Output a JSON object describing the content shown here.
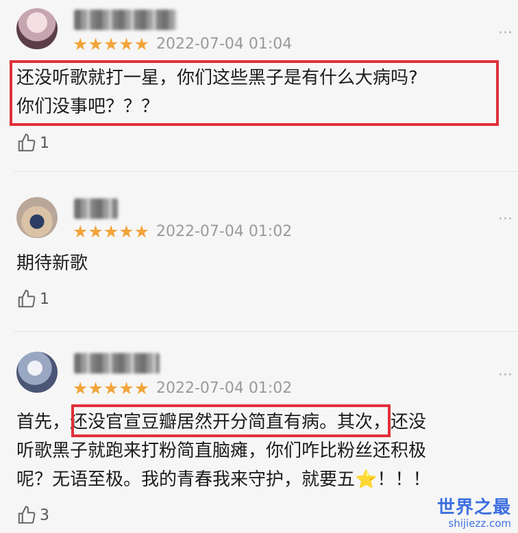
{
  "reviews": [
    {
      "rating_text": "★★★★★",
      "date": "2022-07-04 01:04",
      "text": "还没听歌就打一星，你们这些黑子是有什么大病吗?\n你们没事吧？？？",
      "likes": "1"
    },
    {
      "rating_text": "★★★★★",
      "date": "2022-07-04 01:02",
      "text": "期待新歌",
      "likes": "1"
    },
    {
      "rating_text": "★★★★★",
      "date": "2022-07-04 01:02",
      "text_before_highlight": "首先，",
      "text_highlight": "还没官宣豆瓣居然开分简直有病",
      "text_rest": "。其次，还没\n听歌黑子就跑来打粉简直脑瘫，你们咋比粉丝还积极\n呢？无语至极。我的青春我来守护，就要五",
      "text_end": "！！！",
      "likes": "3"
    }
  ],
  "watermark": {
    "main": "世界之最",
    "sub": "shijiezz.com"
  },
  "colors": {
    "star": "#f2a43a",
    "highlight_border": "#e0303a",
    "watermark": "#3d6fe0"
  },
  "icons": {
    "like": "thumbs-up-icon",
    "more": "more-icon",
    "star_emoji": "star-emoji-icon"
  }
}
